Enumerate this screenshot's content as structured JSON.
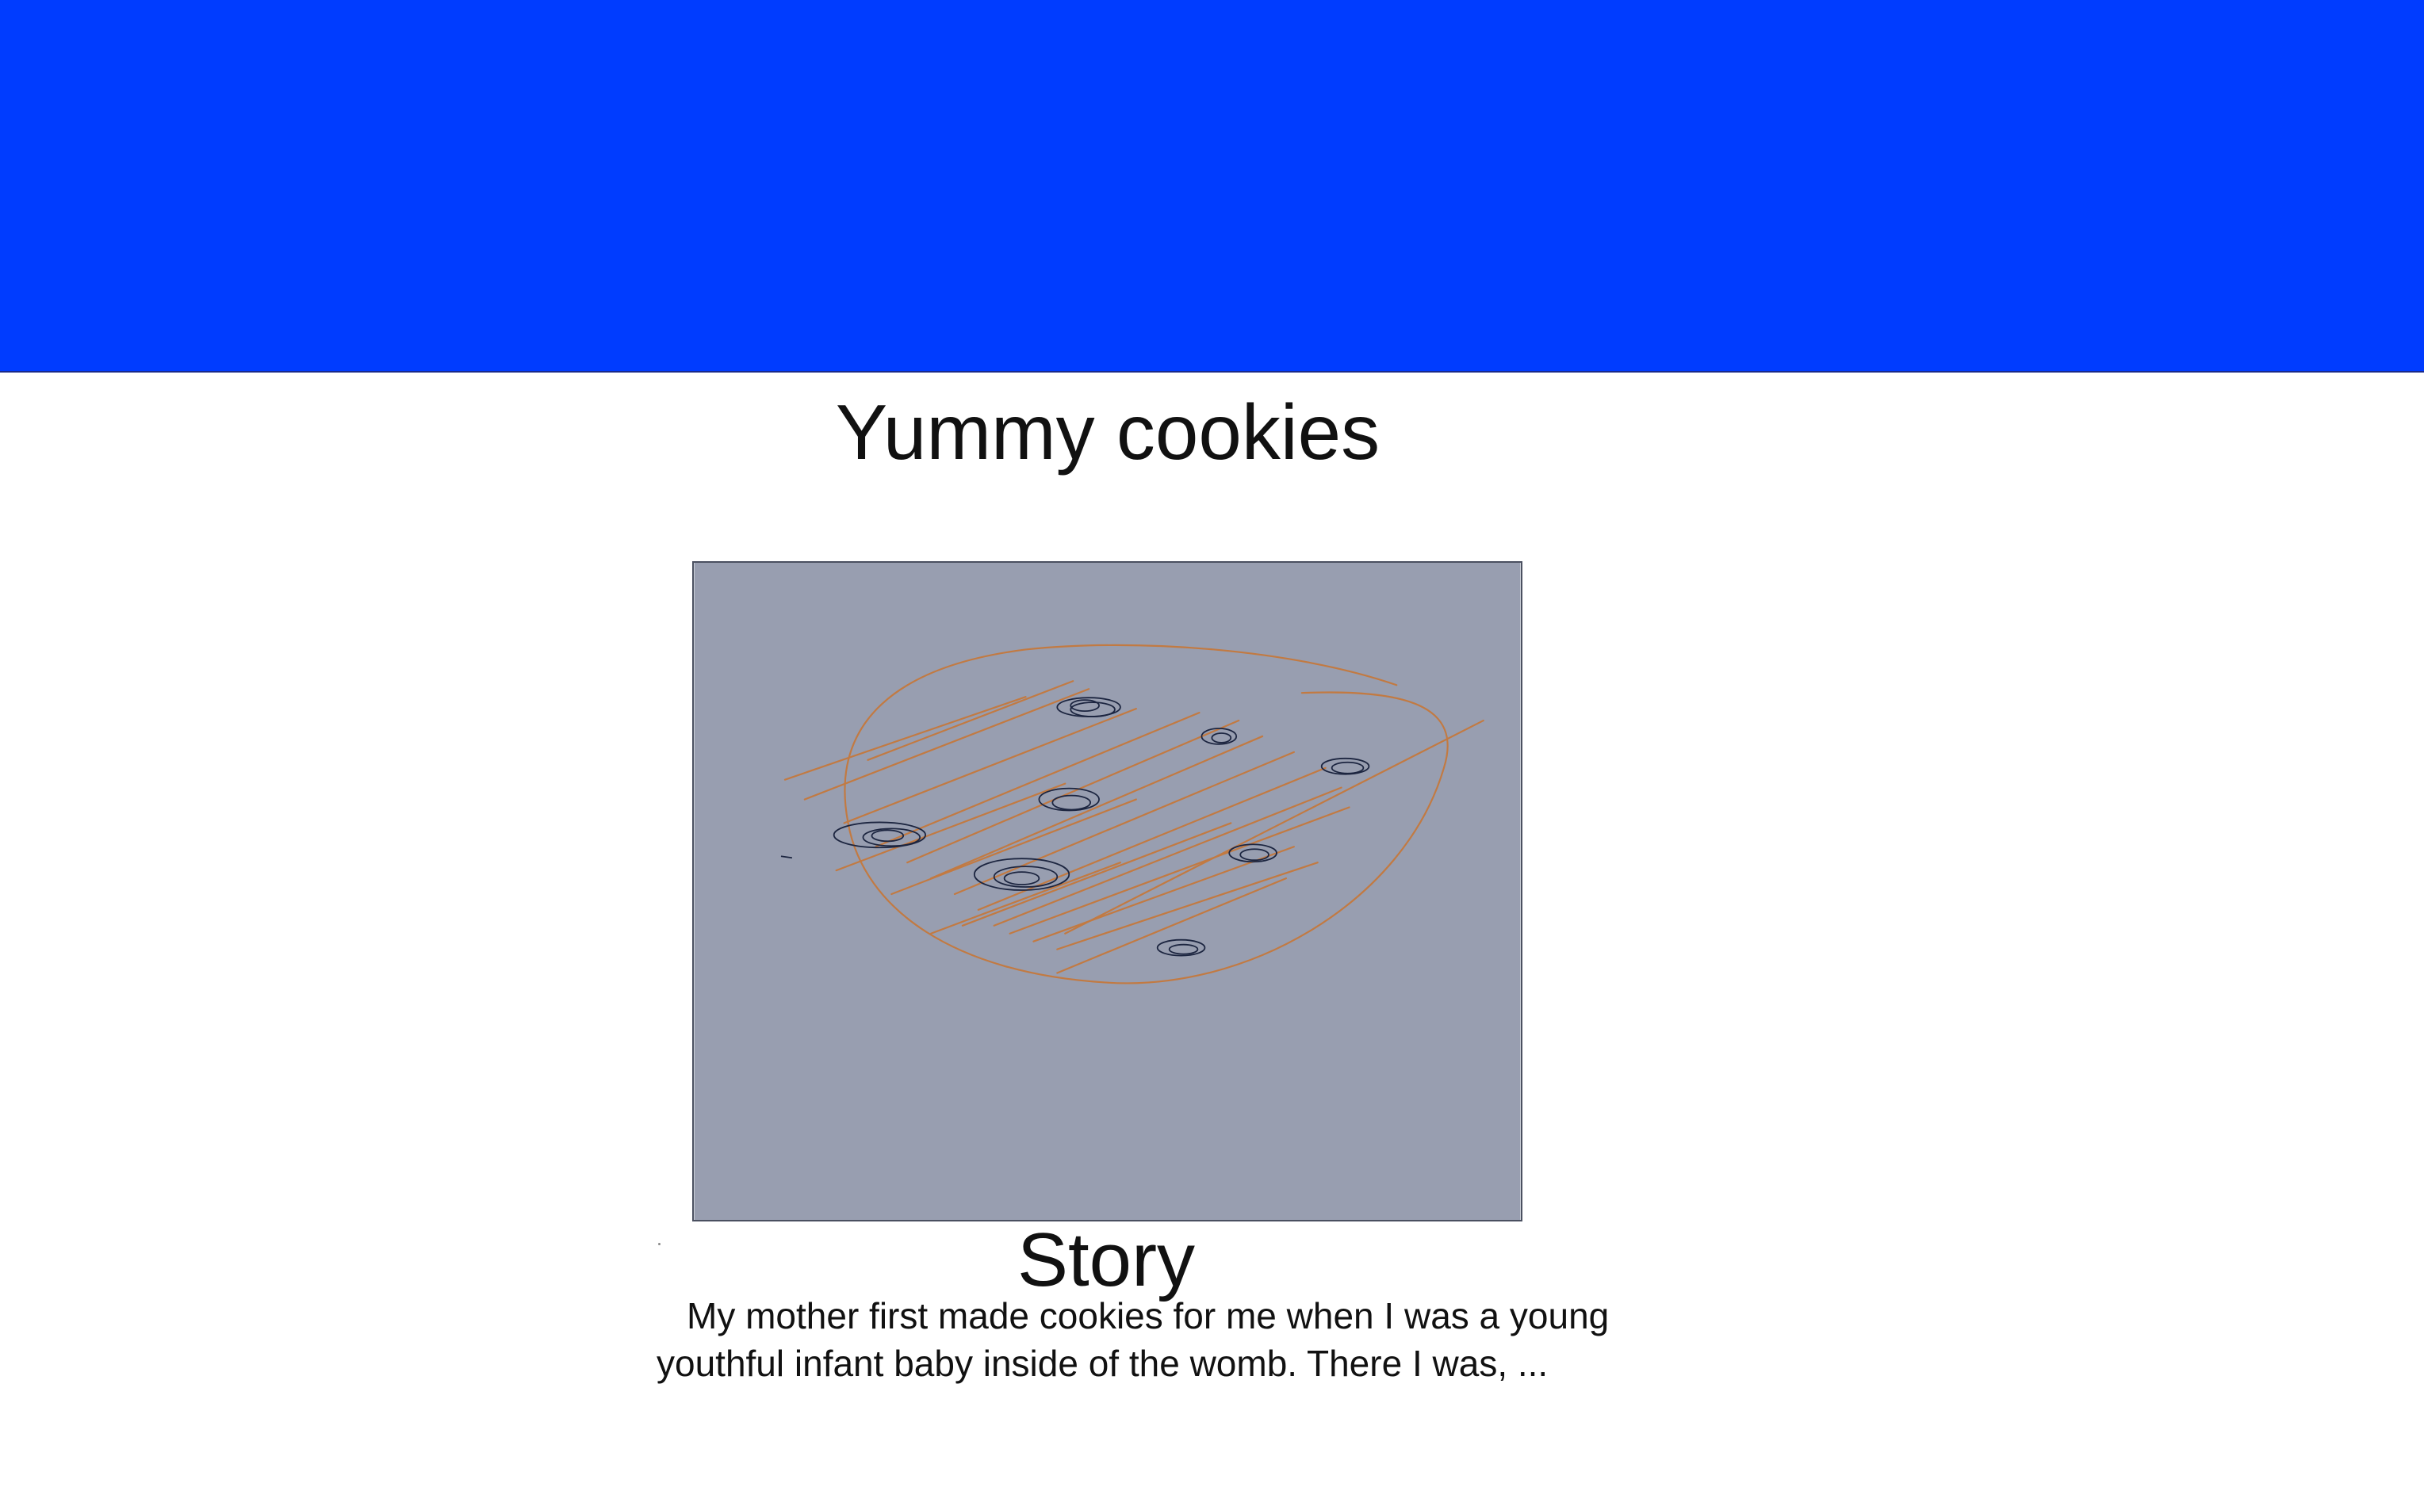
{
  "colors": {
    "banner": "#003cff",
    "image_background": "#989eb0",
    "cookie_outline": "#c27a42",
    "chip_outline": "#1c2540",
    "page_background": "#ffffff"
  },
  "page": {
    "title": "Yummy cookies",
    "image_icon": "cookie-sketch-icon"
  },
  "story": {
    "heading": "Story",
    "body": "My mother first made cookies for me when I was a young youthful infant baby inside of the womb. There I was, ..."
  }
}
